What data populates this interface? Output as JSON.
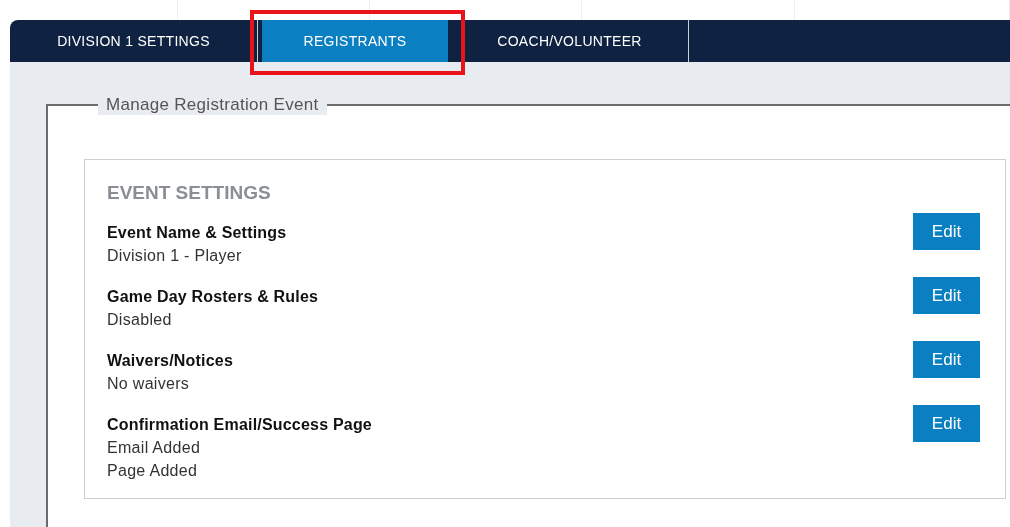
{
  "tabs": [
    {
      "label": "DIVISION 1 SETTINGS",
      "selected": false,
      "highlighted": false
    },
    {
      "label": "REGISTRANTS",
      "selected": true,
      "highlighted": true
    },
    {
      "label": "COACH/VOLUNTEER",
      "selected": false,
      "highlighted": false
    }
  ],
  "fieldset": {
    "legend": "Manage Registration Event"
  },
  "card": {
    "heading": "EVENT SETTINGS",
    "rows": [
      {
        "title": "Event Name & Settings",
        "details": [
          "Division 1 - Player"
        ],
        "button": "Edit"
      },
      {
        "title": "Game Day Rosters & Rules",
        "details": [
          "Disabled"
        ],
        "button": "Edit"
      },
      {
        "title": "Waivers/Notices",
        "details": [
          "No waivers"
        ],
        "button": "Edit"
      },
      {
        "title": "Confirmation Email/Success Page",
        "details": [
          "Email Added",
          "Page Added"
        ],
        "button": "Edit"
      }
    ]
  }
}
